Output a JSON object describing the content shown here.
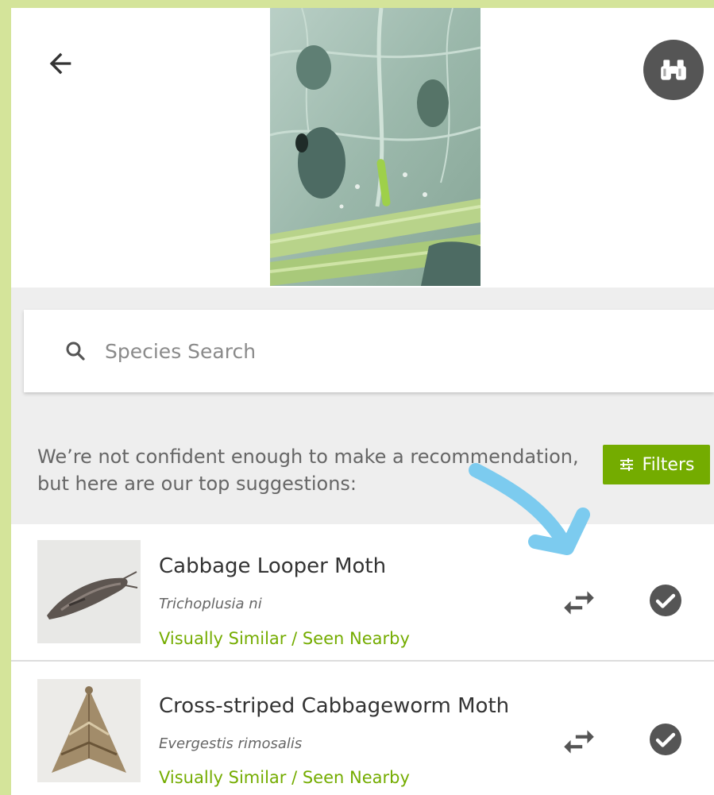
{
  "header": {
    "back_icon": "arrow-left-icon",
    "photo_subject": "leaf-with-caterpillar-photo",
    "binoculars_icon": "binoculars-icon"
  },
  "search": {
    "placeholder": "Species Search",
    "icon": "search-icon"
  },
  "notice": {
    "text": "We’re not confident enough to make a recommendation, but here are our top suggestions:"
  },
  "filters": {
    "label": "Filters",
    "icon": "sliders-icon"
  },
  "suggestions": [
    {
      "common_name": "Cabbage Looper Moth",
      "scientific_name": "Trichoplusia ni",
      "tag": "Visually Similar / Seen Nearby"
    },
    {
      "common_name": "Cross-striped Cabbageworm Moth",
      "scientific_name": "Evergestis rimosalis",
      "tag": "Visually Similar / Seen Nearby"
    }
  ],
  "colors": {
    "accent_green": "#74ac00",
    "frame_green": "#d4e49a",
    "annotation_blue": "#7ccbef",
    "icon_grey": "#555555"
  }
}
